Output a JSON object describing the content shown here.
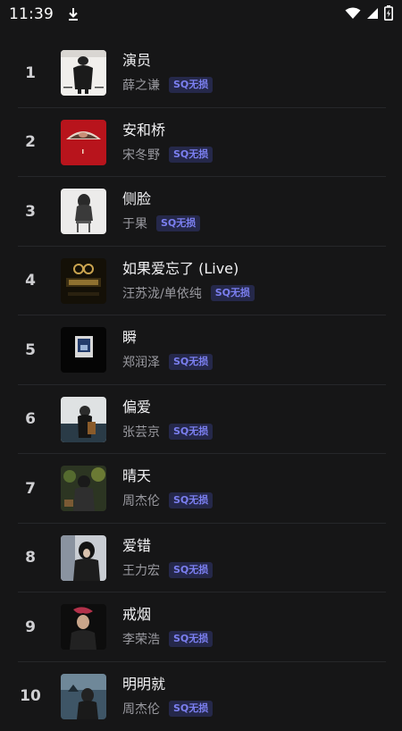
{
  "status_bar": {
    "time": "11:39"
  },
  "songs": [
    {
      "rank": "1",
      "title": "演员",
      "artist": "薛之谦",
      "badge": "SQ无损"
    },
    {
      "rank": "2",
      "title": "安和桥",
      "artist": "宋冬野",
      "badge": "SQ无损"
    },
    {
      "rank": "3",
      "title": "侧脸",
      "artist": "于果",
      "badge": "SQ无损"
    },
    {
      "rank": "4",
      "title": "如果爱忘了 (Live)",
      "artist": "汪苏泷/单依纯",
      "badge": "SQ无损"
    },
    {
      "rank": "5",
      "title": "瞬",
      "artist": "郑润泽",
      "badge": "SQ无损"
    },
    {
      "rank": "6",
      "title": "偏爱",
      "artist": "张芸京",
      "badge": "SQ无损"
    },
    {
      "rank": "7",
      "title": "晴天",
      "artist": "周杰伦",
      "badge": "SQ无损"
    },
    {
      "rank": "8",
      "title": "爱错",
      "artist": "王力宏",
      "badge": "SQ无损"
    },
    {
      "rank": "9",
      "title": "戒烟",
      "artist": "李荣浩",
      "badge": "SQ无损"
    },
    {
      "rank": "10",
      "title": "明明就",
      "artist": "周杰伦",
      "badge": "SQ无损"
    }
  ]
}
